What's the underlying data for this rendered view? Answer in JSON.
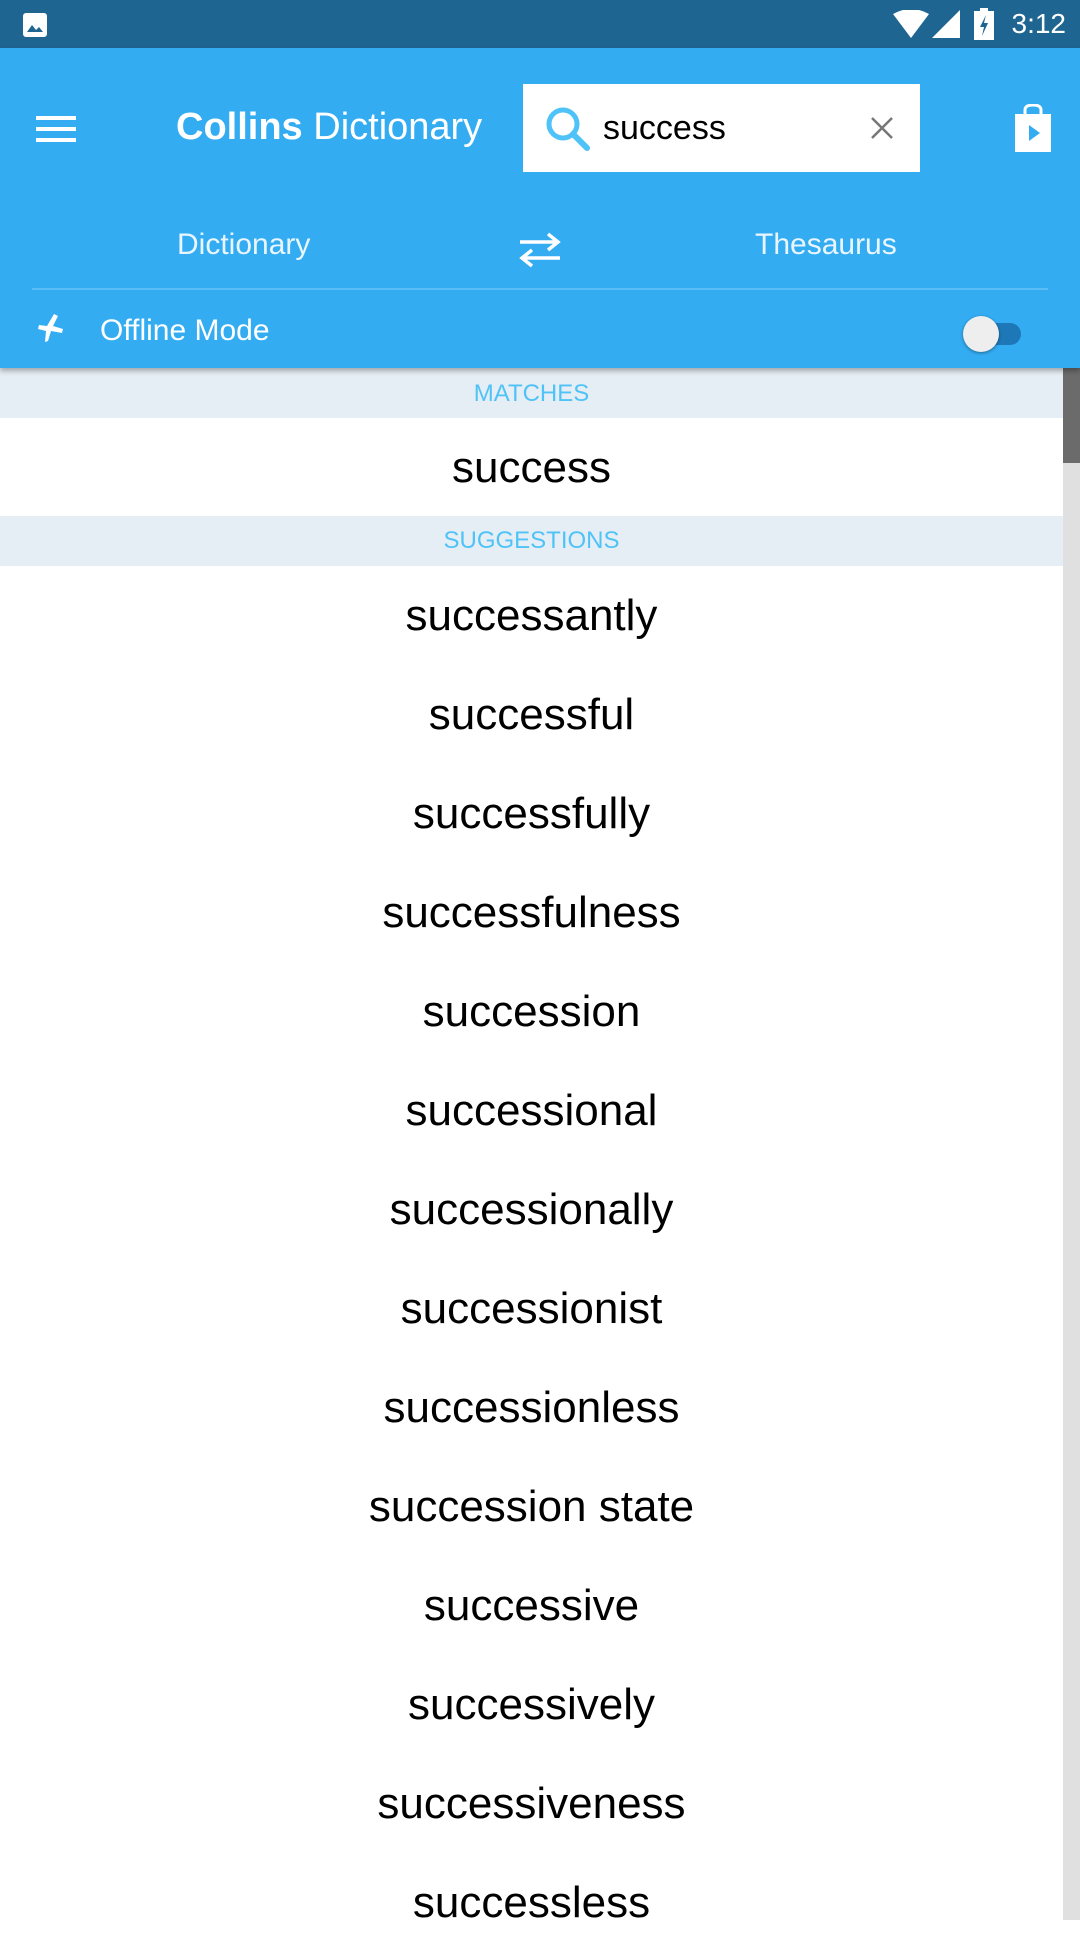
{
  "status_bar": {
    "time": "3:12",
    "icons": [
      "image-notification-icon",
      "wifi-icon",
      "cell-signal-icon",
      "battery-charging-icon"
    ]
  },
  "app_bar": {
    "title_bold": "Collins",
    "title_rest": " Dictionary",
    "search": {
      "value": "success",
      "icon": "search-icon",
      "clear_icon": "close-icon"
    },
    "store_icon": "play-store-bag-icon",
    "tabs": {
      "dictionary": "Dictionary",
      "thesaurus": "Thesaurus",
      "swap_icon": "swap-arrows-icon"
    },
    "offline": {
      "label": "Offline Mode",
      "enabled": false,
      "icon": "airplane-icon"
    },
    "colors": {
      "primary": "#33acf2",
      "status": "#1f6591"
    }
  },
  "results": {
    "matches_header": "MATCHES",
    "matches": [
      "success"
    ],
    "suggestions_header": "SUGGESTIONS",
    "suggestions": [
      "successantly",
      "successful",
      "successfully",
      "successfulness",
      "succession",
      "successional",
      "successionally",
      "successionist",
      "successionless",
      "succession state",
      "successive",
      "successively",
      "successiveness",
      "successless"
    ]
  }
}
